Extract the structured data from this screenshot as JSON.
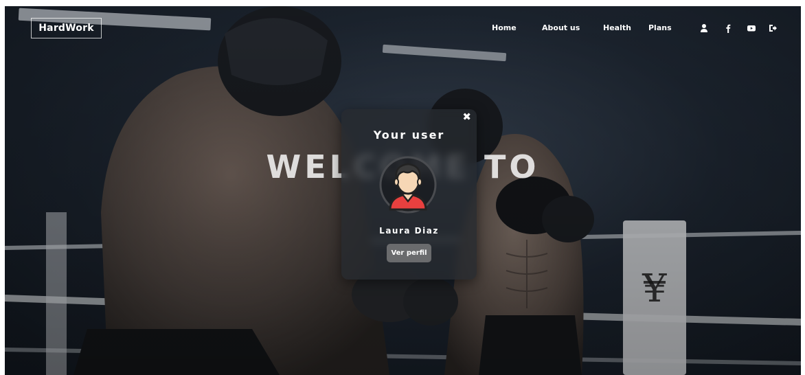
{
  "brand": {
    "logo_text": "HardWork"
  },
  "nav": {
    "links": [
      {
        "label": "Home"
      },
      {
        "label": "About us"
      },
      {
        "label": "Health"
      },
      {
        "label": "Plans"
      }
    ],
    "icons": [
      "user-icon",
      "facebook-icon",
      "youtube-icon",
      "logout-icon"
    ]
  },
  "hero": {
    "title": "WELCOME TO"
  },
  "modal": {
    "close_symbol": "✖",
    "title": "Your user",
    "user_name": "Laura Diaz",
    "profile_button_label": "Ver perfil"
  },
  "colors": {
    "background_dark": "#1f2834",
    "modal_bg": "#262a30",
    "button_bg": "#6a6b6d",
    "text": "#ffffff",
    "avatar_shirt": "#e8403f",
    "avatar_hair": "#3b3b3b",
    "avatar_skin": "#f6d7b5"
  }
}
